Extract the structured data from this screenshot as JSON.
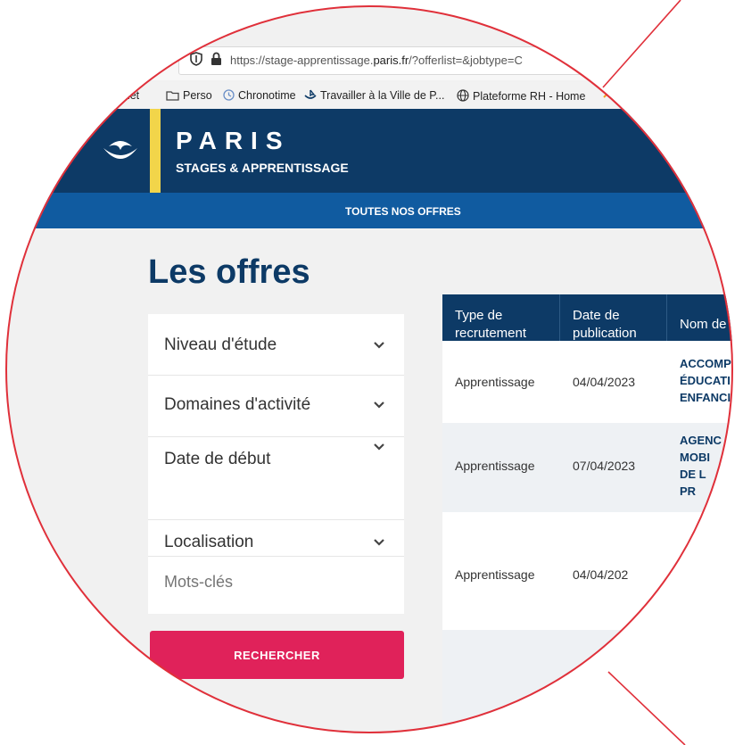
{
  "browser": {
    "url_prefix": "https://stage-apprentissage.",
    "url_domain": "paris.fr",
    "url_suffix": "/?offerlist=&jobtype=C"
  },
  "bookmarks": [
    "inet",
    "Perso",
    "Chronotime",
    "Travailler à la Ville de P...",
    "Plateforme RH - Home"
  ],
  "header": {
    "logo_title": "PARIS",
    "logo_subtitle": "STAGES & APPRENTISSAGE"
  },
  "nav": {
    "all_offers": "TOUTES NOS OFFRES"
  },
  "page_title": "Les offres",
  "filters": [
    {
      "label": "Niveau d'étude"
    },
    {
      "label": "Domaines d'activité"
    },
    {
      "label": "Date de début"
    },
    {
      "label": "Localisation"
    }
  ],
  "keywords_placeholder": "Mots-clés",
  "search_button": "RECHERCHER",
  "table": {
    "headers": [
      "Type de recrutement",
      "Date de publication",
      "Nom de l"
    ],
    "rows": [
      {
        "type": "Apprentissage",
        "date": "04/04/2023",
        "name": [
          "ACCOMP",
          "ÉDUCATI",
          "ENFANCI"
        ]
      },
      {
        "type": "Apprentissage",
        "date": "07/04/2023",
        "name": [
          "AGENC",
          "MOBI",
          "DE L",
          "PR"
        ]
      },
      {
        "type": "Apprentissage",
        "date": "04/04/202",
        "name": []
      }
    ]
  },
  "colors": {
    "header_navy": "#0d3a66",
    "nav_blue": "#105ba0",
    "accent_yellow": "#f2d54a",
    "button_pink": "#e0225a",
    "magnifier_red": "#e0303a"
  }
}
